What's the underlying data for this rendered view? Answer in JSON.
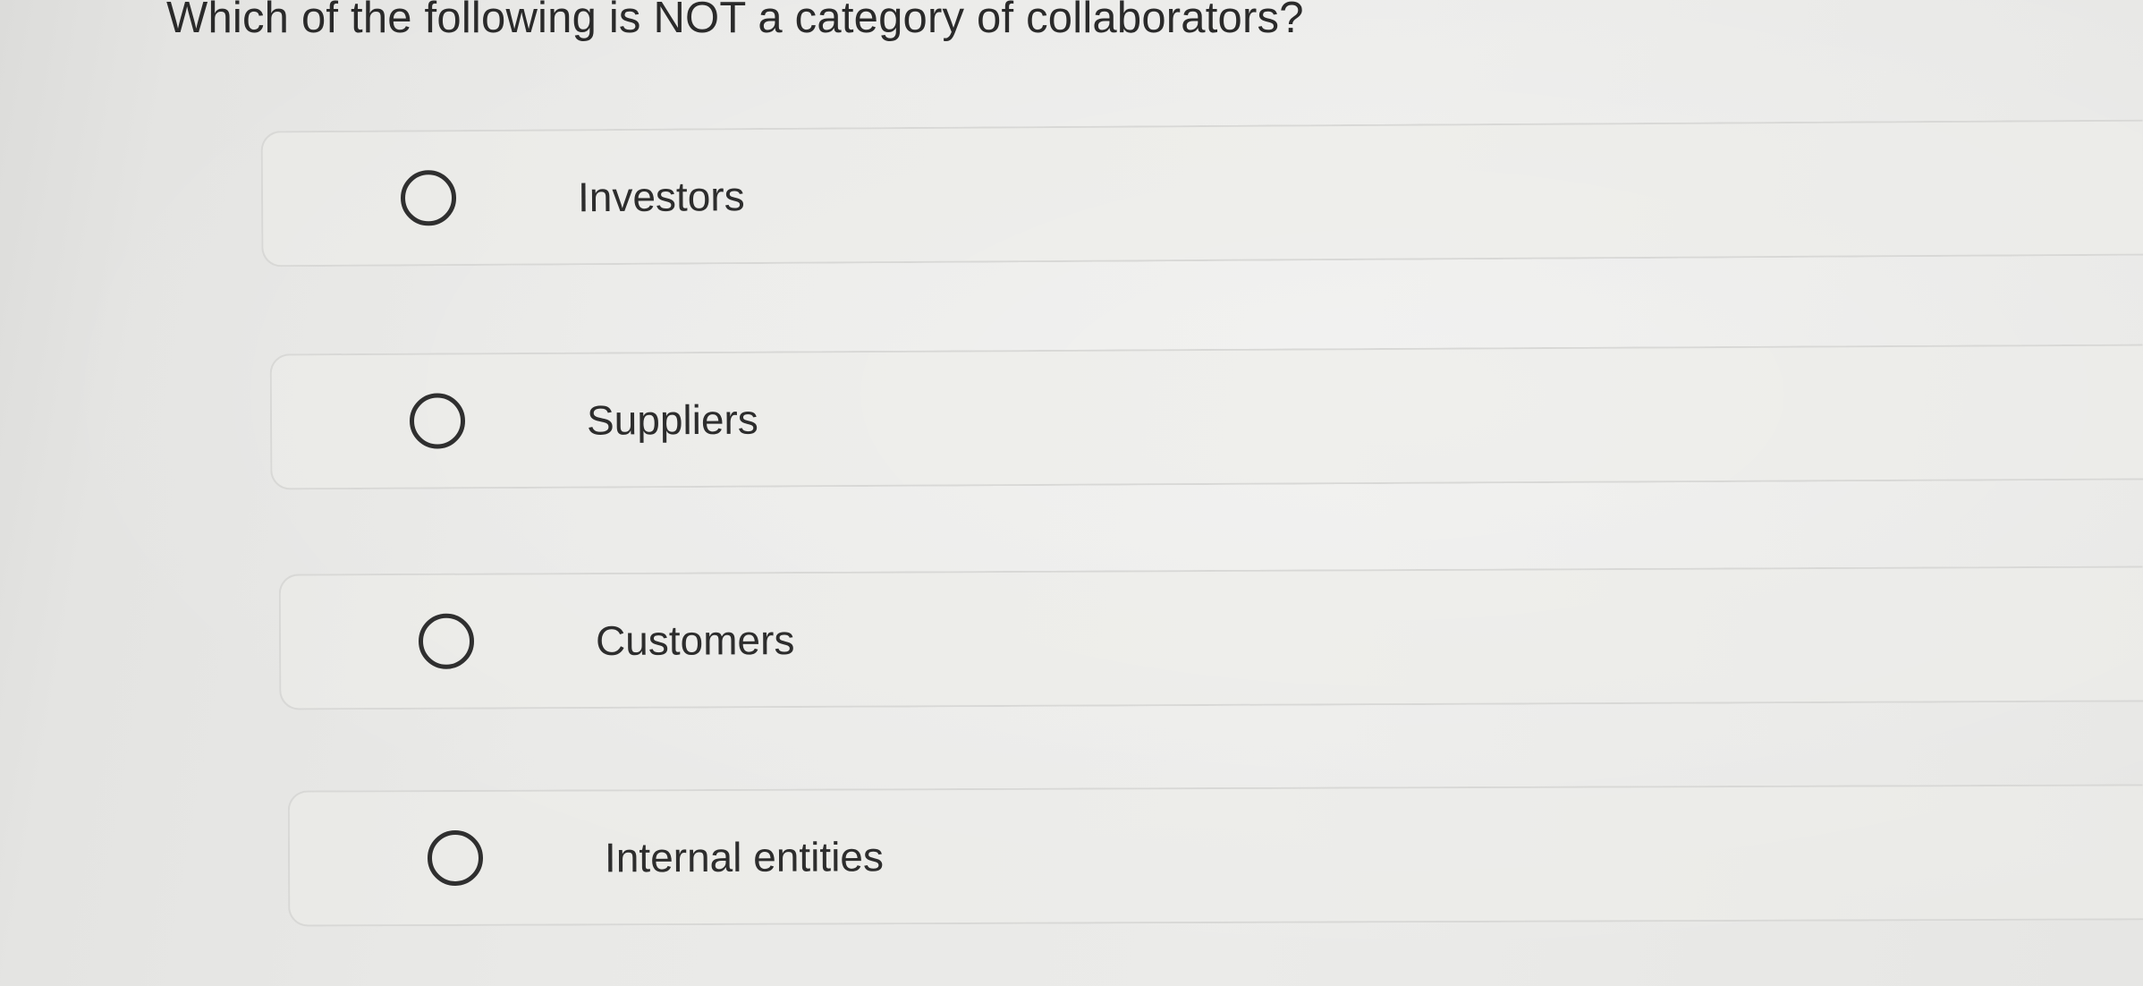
{
  "question": {
    "text": "Which of the following is NOT a category of collaborators?"
  },
  "options": [
    {
      "label": "Investors",
      "selected": false
    },
    {
      "label": "Suppliers",
      "selected": false
    },
    {
      "label": "Customers",
      "selected": false
    },
    {
      "label": "Internal entities",
      "selected": false
    }
  ],
  "colors": {
    "background": "#e9e9e7",
    "text": "#2c2c2c",
    "radio_border": "#2f2f2f",
    "option_border": "#d8d8d6"
  }
}
